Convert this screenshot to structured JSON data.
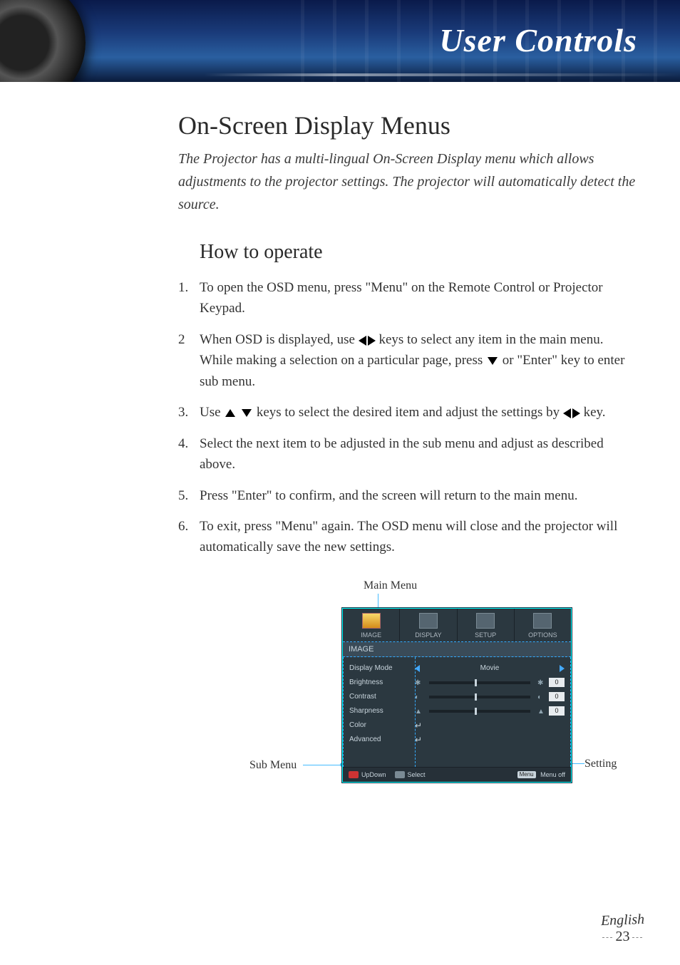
{
  "header": {
    "title": "User Controls"
  },
  "section": {
    "h1": "On-Screen Display Menus",
    "intro": "The Projector has a multi-lingual On-Screen Display menu which allows adjustments to the projector settings. The projector will automatically detect the source.",
    "h2": "How to operate"
  },
  "steps": [
    {
      "num": "1.",
      "pre": "To open the OSD menu, press \"Menu\" on the Remote Control or Projector Keypad.",
      "post": ""
    },
    {
      "num": "2",
      "pre": "When OSD is displayed, use ",
      "mid": " keys to select any item in the main menu. While making a selection on a particular page, press ",
      "post": " or \"Enter\" key to enter sub menu.",
      "icons1": "lr",
      "icons2": "d"
    },
    {
      "num": "3.",
      "pre": "Use ",
      "mid": " keys to select the desired item and adjust the settings by ",
      "post": " key.",
      "icons1": "ud",
      "icons2": "lr"
    },
    {
      "num": "4.",
      "pre": "Select the next item to be adjusted in the sub menu and adjust as described above.",
      "post": ""
    },
    {
      "num": "5.",
      "pre": "Press \"Enter\" to confirm, and the screen will return to the main menu.",
      "post": ""
    },
    {
      "num": "6.",
      "pre": "To exit, press \"Menu\" again. The OSD menu will close and the projector will automatically save the new settings.",
      "post": ""
    }
  ],
  "diagram": {
    "labels": {
      "main": "Main Menu",
      "sub": "Sub Menu",
      "setting": "Setting"
    },
    "osd": {
      "tabs": [
        "IMAGE",
        "DISPLAY",
        "SETUP",
        "OPTIONS"
      ],
      "section_title": "IMAGE",
      "rows": {
        "display_mode": {
          "label": "Display Mode",
          "value": "Movie"
        },
        "brightness": {
          "label": "Brightness",
          "value": "0"
        },
        "contrast": {
          "label": "Contrast",
          "value": "0"
        },
        "sharpness": {
          "label": "Sharpness",
          "value": "0"
        },
        "color": {
          "label": "Color"
        },
        "advanced": {
          "label": "Advanced"
        }
      },
      "footer": {
        "updown": "UpDown",
        "select": "Select",
        "menu_key": "Menu",
        "menuoff": "Menu off"
      }
    }
  },
  "footer": {
    "language": "English",
    "page": "23"
  }
}
